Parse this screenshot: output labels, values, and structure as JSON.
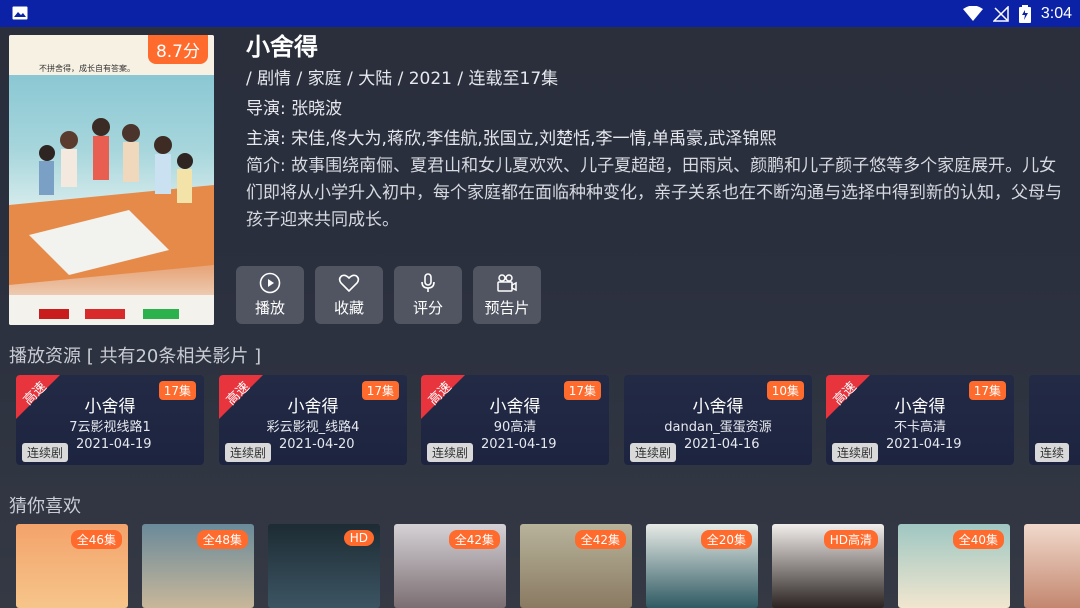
{
  "status_bar": {
    "time": "3:04",
    "icons": [
      "image-icon",
      "wifi-icon",
      "no-signal-icon",
      "battery-icon"
    ]
  },
  "detail": {
    "title": "小舍得",
    "rating": "8.7分",
    "poster_tagline": "不拼舍得，成长自有答案。",
    "meta": " / 剧情 / 家庭 / 大陆 / 2021 / 连载至17集",
    "director": "导演: 张晓波",
    "cast": "主演: 宋佳,佟大为,蒋欣,李佳航,张国立,刘楚恬,李一情,单禹豪,武泽锦熙",
    "description": "简介: 故事围绕南俪、夏君山和女儿夏欢欢、儿子夏超超，田雨岚、颜鹏和儿子颜子悠等多个家庭展开。儿女们即将从小学升入初中，每个家庭都在面临种种变化，亲子关系也在不断沟通与选择中得到新的认知，父母与孩子迎来共同成长。"
  },
  "actions": [
    {
      "label": "播放",
      "icon": "play-icon"
    },
    {
      "label": "收藏",
      "icon": "heart-icon"
    },
    {
      "label": "评分",
      "icon": "mic-icon"
    },
    {
      "label": "预告片",
      "icon": "video-camera-icon"
    }
  ],
  "sources_title": "播放资源 [ 共有20条相关影片 ]",
  "sources": [
    {
      "name": "小舍得",
      "line": "7云影视线路1",
      "date": "2021-04-19",
      "episodes": "17集",
      "corner": "高速",
      "tag": "连续剧"
    },
    {
      "name": "小舍得",
      "line": "彩云影视_线路4",
      "date": "2021-04-20",
      "episodes": "17集",
      "corner": "高速",
      "tag": "连续剧"
    },
    {
      "name": "小舍得",
      "line": "90高清",
      "date": "2021-04-19",
      "episodes": "17集",
      "corner": "高速",
      "tag": "连续剧"
    },
    {
      "name": "小舍得",
      "line": "dandan_蛋蛋资源",
      "date": "2021-04-16",
      "episodes": "10集",
      "corner": "",
      "tag": "连续剧"
    },
    {
      "name": "小舍得",
      "line": "不卡高清",
      "date": "2021-04-19",
      "episodes": "17集",
      "corner": "高速",
      "tag": "连续剧"
    },
    {
      "name": "",
      "line": "",
      "date": "",
      "episodes": "",
      "corner": "",
      "tag": "连续"
    }
  ],
  "recommend_title": "猜你喜欢",
  "recommendations": [
    {
      "badge": "全46集",
      "colors": [
        "#f3a36b",
        "#f6c58a"
      ]
    },
    {
      "badge": "全48集",
      "colors": [
        "#6a8a9a",
        "#c8b79a"
      ]
    },
    {
      "badge": "HD",
      "colors": [
        "#1d2b33",
        "#3c5563"
      ]
    },
    {
      "badge": "全42集",
      "colors": [
        "#d5d2d6",
        "#7b6e72"
      ]
    },
    {
      "badge": "全42集",
      "colors": [
        "#b8b39b",
        "#8a7a62"
      ]
    },
    {
      "badge": "全20集",
      "colors": [
        "#e7ebe6",
        "#2f5a63"
      ]
    },
    {
      "badge": "HD高清",
      "colors": [
        "#f2eeec",
        "#2a2321"
      ]
    },
    {
      "badge": "全40集",
      "colors": [
        "#9fc7c2",
        "#f1e6cf"
      ]
    },
    {
      "badge": "",
      "colors": [
        "#f1d9cc",
        "#c3876f"
      ]
    }
  ]
}
